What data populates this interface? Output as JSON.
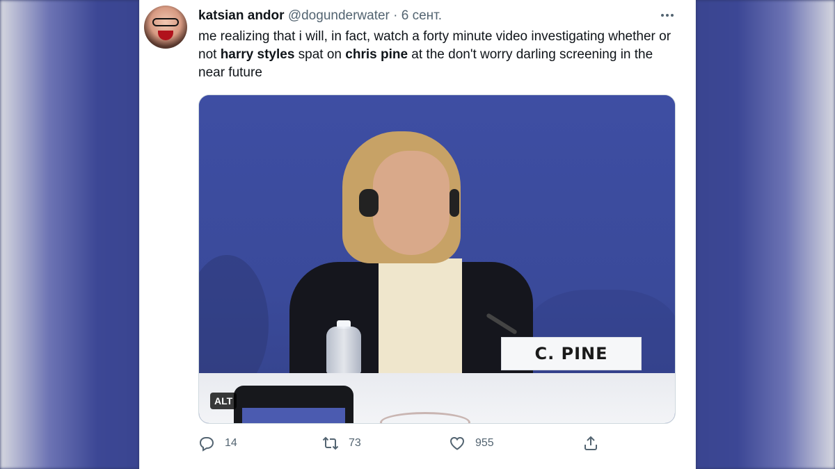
{
  "tweet": {
    "display_name": "katsian andor",
    "handle": "@dogunderwater",
    "separator": "·",
    "timestamp": "6 сент.",
    "text_parts": {
      "p1": "me realizing that i will, in fact, watch a forty minute video investigating whether or not ",
      "bold1": "harry styles",
      "p2": " spat on ",
      "bold2": "chris pine",
      "p3": " at the don't worry darling screening in the near future"
    },
    "media": {
      "alt_badge": "ALT",
      "nameplate": "C. PINE"
    },
    "actions": {
      "reply_count": "14",
      "retweet_count": "73",
      "like_count": "955"
    }
  },
  "icons": {
    "more": "more-icon",
    "reply": "reply-icon",
    "retweet": "retweet-icon",
    "like": "heart-icon",
    "share": "share-icon"
  },
  "colors": {
    "text_primary": "#0f1419",
    "text_secondary": "#536471",
    "background": "#ffffff"
  }
}
